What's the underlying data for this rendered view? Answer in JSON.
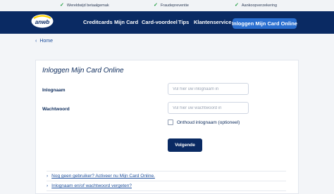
{
  "usps": [
    {
      "label": "Wereldwijd betaalgemak"
    },
    {
      "label": "Fraudepreventie"
    },
    {
      "label": "Aankoopverzekering"
    }
  ],
  "header": {
    "logo_text": "anwb",
    "nav": [
      "Creditcards",
      "Mijn Card",
      "Card-voordeel",
      "Tips",
      "Klantenservice"
    ],
    "login_button": "Inloggen Mijn Card Online"
  },
  "breadcrumb": {
    "chevron": "‹",
    "home": "Home"
  },
  "form": {
    "title": "Inloggen Mijn Card Online",
    "username_label": "Inlognaam",
    "username_placeholder": "Vul hier uw inlognaam in",
    "password_label": "Wachtwoord",
    "password_placeholder": "Vul hier uw wachtwoord in",
    "remember_label": "Onthoud inlognaam (optioneel)",
    "submit": "Volgende"
  },
  "links": [
    {
      "chevron": "›",
      "label": "Nog geen gebruiker? Activeer nu Mijn Card Online."
    },
    {
      "chevron": "›",
      "label": "Inlognaam en/of wachtwoord vergeten?"
    }
  ],
  "colors": {
    "brand_navy": "#0a2a63",
    "accent_blue": "#2a6fd0",
    "check_green": "#1a9b3a",
    "logo_yellow": "#ffd400"
  }
}
